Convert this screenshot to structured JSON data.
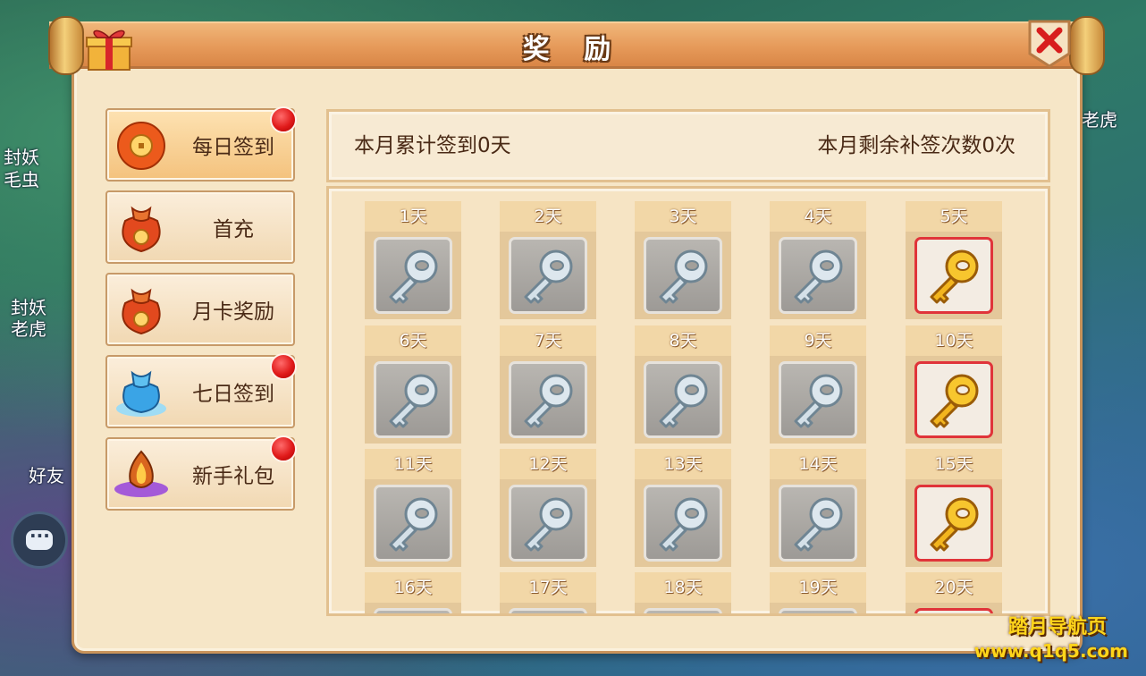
{
  "background": {
    "texts": [
      "封妖",
      "毛虫",
      "封妖",
      "老虎",
      "好友",
      "老虎"
    ]
  },
  "window": {
    "title": "奖 励",
    "gift_icon": "gift-box-icon",
    "close_icon": "close-icon"
  },
  "menu": {
    "items": [
      {
        "label": "每日签到",
        "icon": "lantern-coin-icon",
        "badge": true,
        "active": true
      },
      {
        "label": "首充",
        "icon": "fortune-bag-icon",
        "badge": false,
        "active": false
      },
      {
        "label": "月卡奖励",
        "icon": "fortune-bag-icon",
        "badge": false,
        "active": false
      },
      {
        "label": "七日签到",
        "icon": "blue-bag-icon",
        "badge": true,
        "active": false
      },
      {
        "label": "新手礼包",
        "icon": "fire-gem-icon",
        "badge": true,
        "active": false
      }
    ]
  },
  "signin": {
    "total_text": "本月累计签到0天",
    "remaining_text": "本月剩余补签次数0次"
  },
  "days": [
    {
      "label": "1天",
      "item": "silver-key"
    },
    {
      "label": "2天",
      "item": "silver-key"
    },
    {
      "label": "3天",
      "item": "silver-key"
    },
    {
      "label": "4天",
      "item": "silver-key"
    },
    {
      "label": "5天",
      "item": "gold-key"
    },
    {
      "label": "6天",
      "item": "silver-key"
    },
    {
      "label": "7天",
      "item": "silver-key"
    },
    {
      "label": "8天",
      "item": "silver-key"
    },
    {
      "label": "9天",
      "item": "silver-key"
    },
    {
      "label": "10天",
      "item": "gold-key"
    },
    {
      "label": "11天",
      "item": "silver-key"
    },
    {
      "label": "12天",
      "item": "silver-key"
    },
    {
      "label": "13天",
      "item": "silver-key"
    },
    {
      "label": "14天",
      "item": "silver-key"
    },
    {
      "label": "15天",
      "item": "gold-key"
    },
    {
      "label": "16天",
      "item": "silver-key"
    },
    {
      "label": "17天",
      "item": "silver-key"
    },
    {
      "label": "18天",
      "item": "silver-key"
    },
    {
      "label": "19天",
      "item": "silver-key"
    },
    {
      "label": "20天",
      "item": "gold-key"
    }
  ],
  "watermark": {
    "line1": "踏月导航页",
    "line2": "www.q1q5.com"
  },
  "colors": {
    "panel_bg": "#f6e6c7",
    "title_bar": "#e69a5a",
    "badge_red": "#e01a1a",
    "gold_frame": "#e0343a"
  }
}
